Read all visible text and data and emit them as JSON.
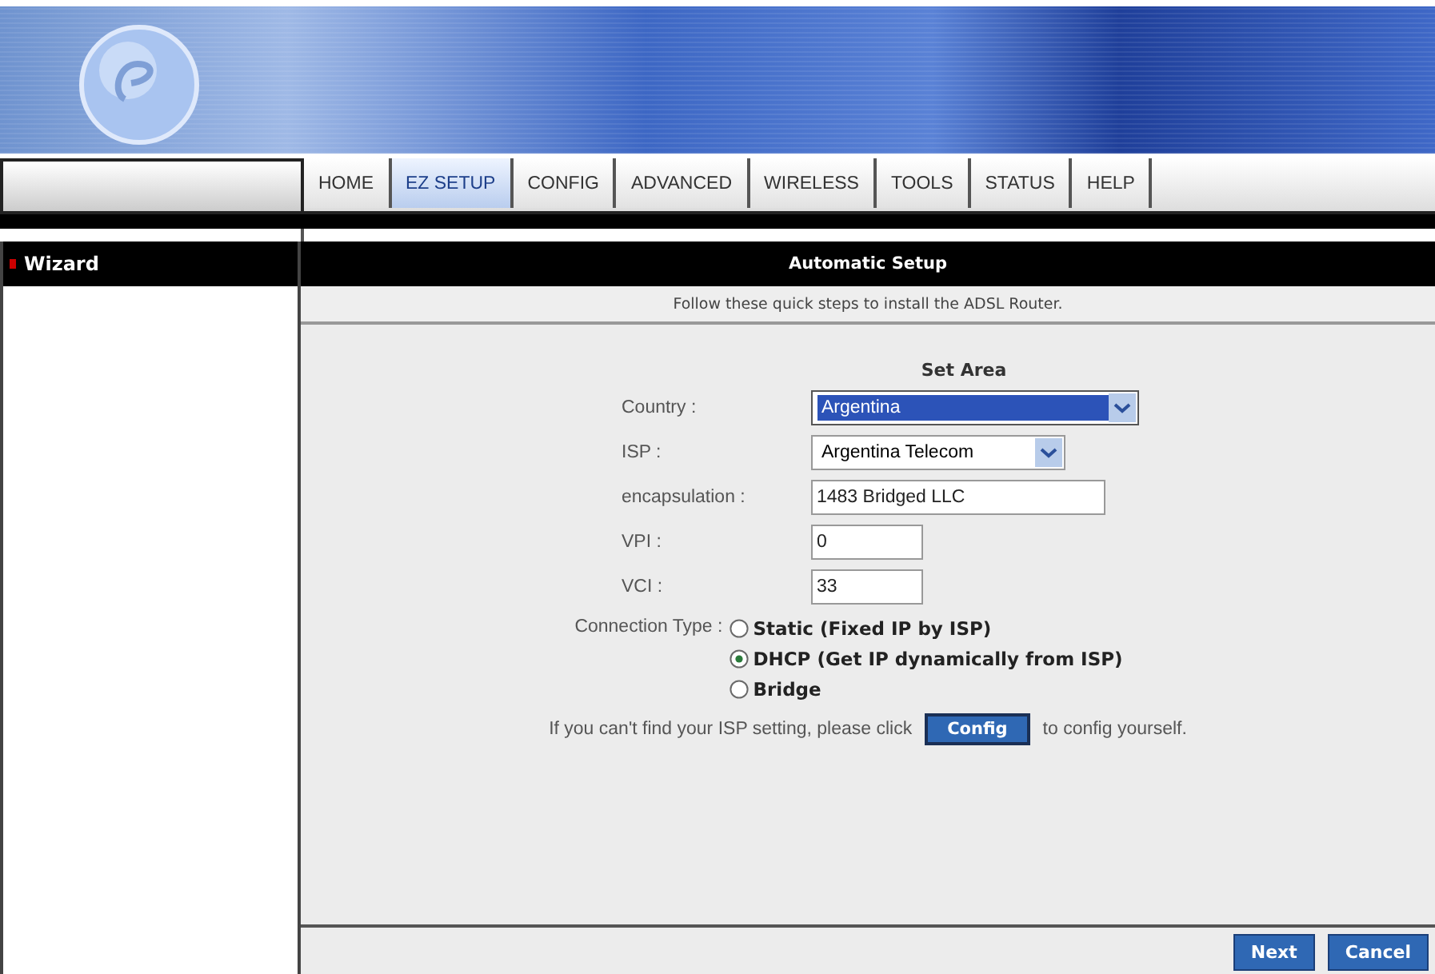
{
  "nav_tabs": [
    {
      "label": "HOME",
      "selected": false
    },
    {
      "label": "EZ SETUP",
      "selected": true
    },
    {
      "label": "CONFIG",
      "selected": false
    },
    {
      "label": "ADVANCED",
      "selected": false
    },
    {
      "label": "WIRELESS",
      "selected": false
    },
    {
      "label": "TOOLS",
      "selected": false
    },
    {
      "label": "STATUS",
      "selected": false
    },
    {
      "label": "HELP",
      "selected": false
    }
  ],
  "sidebar": {
    "items": [
      {
        "label": "Wizard",
        "selected": true
      }
    ]
  },
  "panel": {
    "title": "Automatic Setup",
    "subtitle": "Follow these quick steps to install the ADSL Router.",
    "section_title": "Set Area",
    "fields": [
      {
        "label": "Country :",
        "kind": "select",
        "value": "Argentina",
        "focused": true
      },
      {
        "label": "ISP :",
        "kind": "select",
        "value": "Argentina Telecom",
        "focused": false
      },
      {
        "label": "encapsulation :",
        "kind": "text",
        "value": "1483 Bridged LLC"
      },
      {
        "label": "VPI :",
        "kind": "text",
        "value": "0"
      },
      {
        "label": "VCI :",
        "kind": "text",
        "value": "33"
      }
    ],
    "connection_type": {
      "label": "Connection Type :",
      "options": [
        {
          "label": "Static (Fixed IP by ISP)",
          "selected": false
        },
        {
          "label": "DHCP (Get IP dynamically from ISP)",
          "selected": true
        },
        {
          "label": "Bridge",
          "selected": false
        }
      ]
    },
    "hint_before": "If you can't find your ISP setting, please click",
    "config_button": "Config",
    "hint_after": "to config yourself.",
    "buttons": [
      "Next",
      "Cancel"
    ]
  }
}
